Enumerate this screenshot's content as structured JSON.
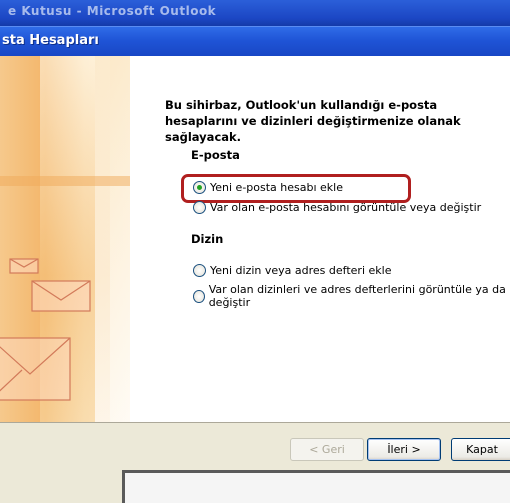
{
  "background_window": {
    "title": "e Kutusu - Microsoft Outlook"
  },
  "dialog": {
    "title": "sta Hesapları",
    "intro": "Bu sihirbaz, Outlook'un kullandığı e-posta hesaplarını ve dizinleri değiştirmenize olanak sağlayacak.",
    "email_section": {
      "heading": "E-posta",
      "options": [
        {
          "label": "Yeni e-posta hesabı ekle",
          "selected": true
        },
        {
          "label": "Var olan e-posta hesabını görüntüle veya değiştir",
          "selected": false
        }
      ]
    },
    "directory_section": {
      "heading": "Dizin",
      "options": [
        {
          "label": "Yeni dizin veya adres defteri ekle",
          "selected": false
        },
        {
          "label": "Var olan dizinleri ve adres defterlerini görüntüle ya da değiştir",
          "selected": false
        }
      ]
    },
    "buttons": {
      "back": "< Geri",
      "next": "İleri >",
      "close": "Kapat"
    }
  },
  "colors": {
    "title_bar": "#1f54d6",
    "highlight": "#b01f1f",
    "radio_dot": "#21a121"
  }
}
